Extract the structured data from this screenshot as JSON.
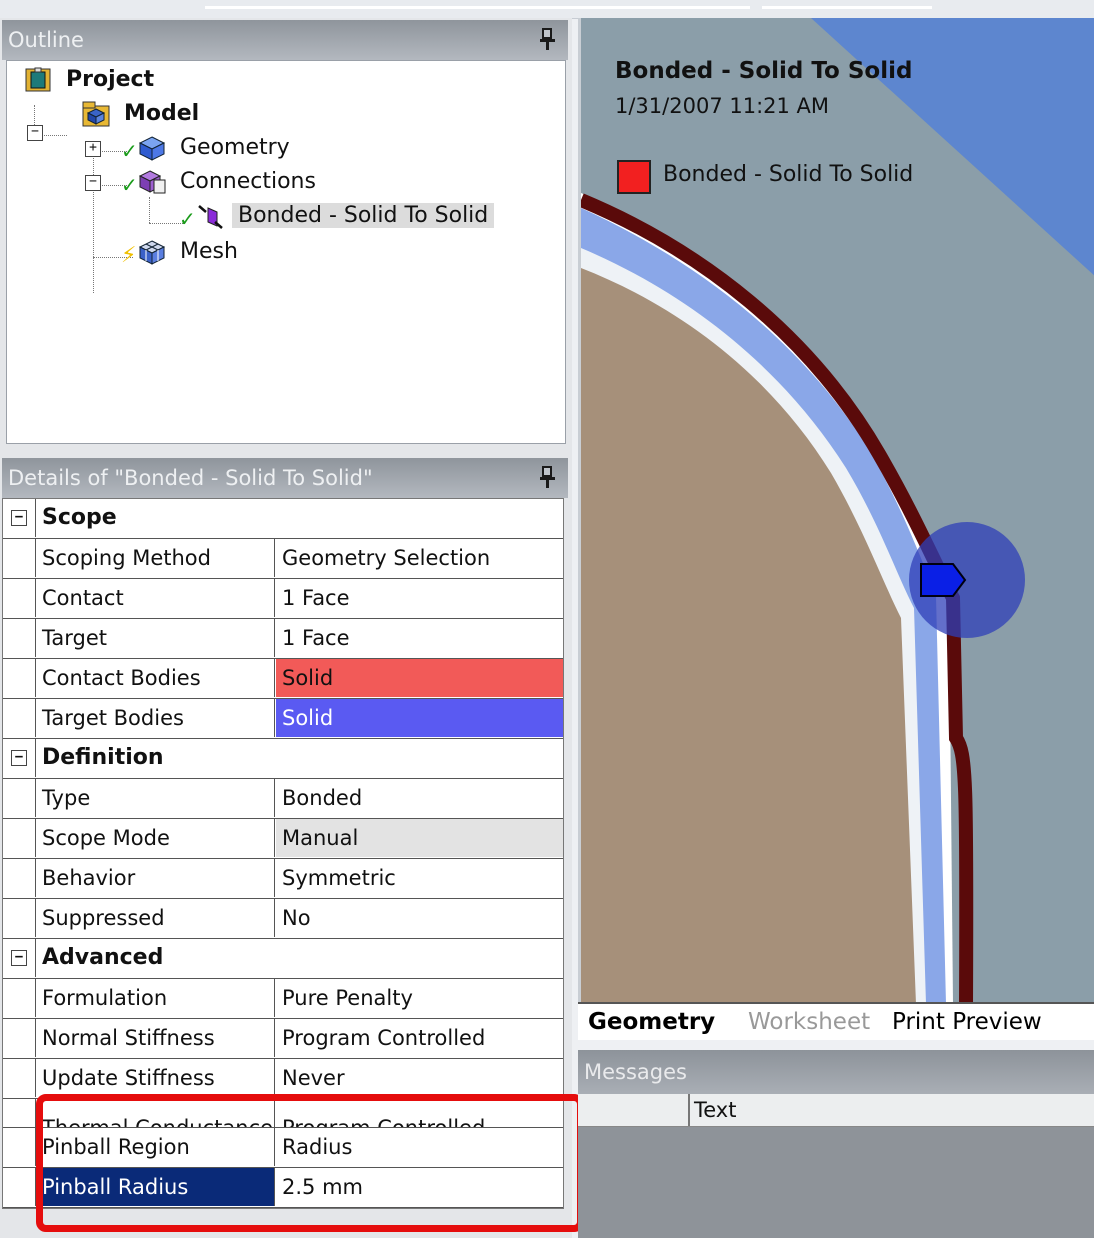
{
  "outline": {
    "title": "Outline",
    "tree": {
      "project": "Project",
      "model": "Model",
      "geometry": "Geometry",
      "connections": "Connections",
      "bonded": "Bonded - Solid To Solid",
      "mesh": "Mesh"
    }
  },
  "details": {
    "title": "Details of \"Bonded - Solid To Solid\"",
    "groups": {
      "scope": "Scope",
      "definition": "Definition",
      "advanced": "Advanced"
    },
    "rows": {
      "scoping_method": {
        "k": "Scoping Method",
        "v": "Geometry Selection"
      },
      "contact": {
        "k": "Contact",
        "v": "1 Face"
      },
      "target": {
        "k": "Target",
        "v": "1 Face"
      },
      "contact_bodies": {
        "k": "Contact Bodies",
        "v": "Solid"
      },
      "target_bodies": {
        "k": "Target Bodies",
        "v": "Solid"
      },
      "type": {
        "k": "Type",
        "v": "Bonded"
      },
      "scope_mode": {
        "k": "Scope Mode",
        "v": "Manual"
      },
      "behavior": {
        "k": "Behavior",
        "v": "Symmetric"
      },
      "suppressed": {
        "k": "Suppressed",
        "v": "No"
      },
      "formulation": {
        "k": "Formulation",
        "v": "Pure Penalty"
      },
      "normal_stiffness": {
        "k": "Normal Stiffness",
        "v": "Program Controlled"
      },
      "update_stiffness": {
        "k": "Update Stiffness",
        "v": "Never"
      },
      "thermal_conductance": {
        "k": "Thermal Conductance",
        "v": "Program Controlled"
      },
      "pinball_region": {
        "k": "Pinball Region",
        "v": "Radius"
      },
      "pinball_radius": {
        "k": "Pinball Radius",
        "v": "2.5 mm"
      }
    }
  },
  "viewport": {
    "title": "Bonded - Solid To Solid",
    "date": "1/31/2007 11:21 AM",
    "legend_label": "Bonded - Solid To Solid"
  },
  "tabs": {
    "geometry": "Geometry",
    "worksheet": "Worksheet",
    "print_preview": "Print Preview"
  },
  "messages": {
    "title": "Messages",
    "col_text": "Text"
  },
  "colors": {
    "contact_red": "#f25a58",
    "target_blue": "#5a5af2",
    "selection_navy": "#0a2a78",
    "highlight_box": "#e50d0d"
  }
}
